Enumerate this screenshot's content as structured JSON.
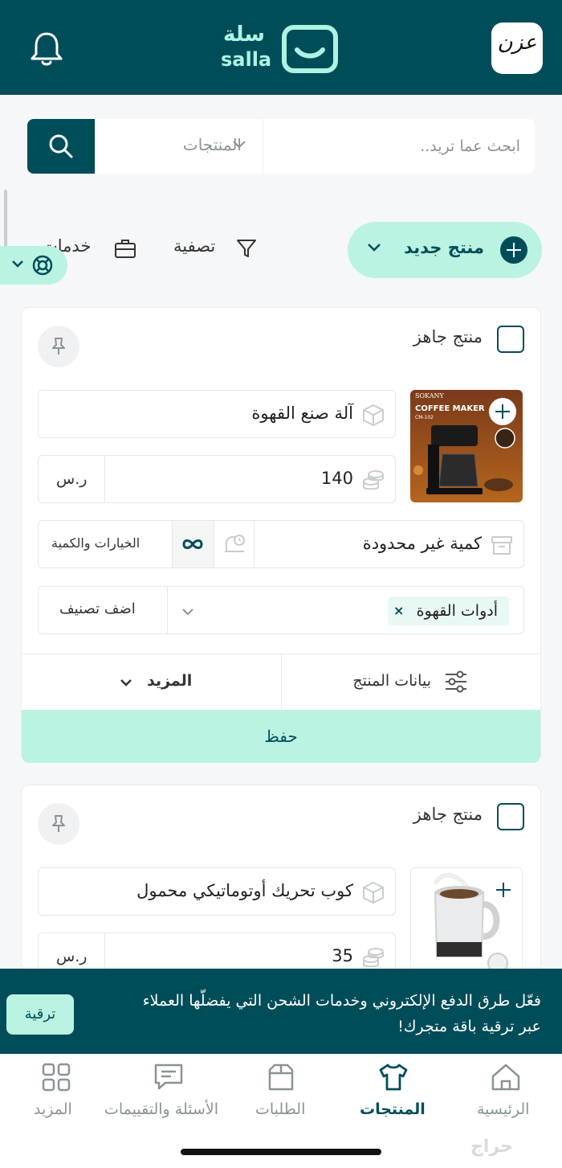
{
  "header": {
    "logo_ar": "سلة",
    "logo_en": "salla",
    "avatar_text": "عزن",
    "bell_icon": "bell-icon",
    "brand_color": "#004d5a",
    "accent_color": "#baf3e2"
  },
  "search": {
    "placeholder": "ابحث عما تريد..",
    "category": "المنتجات"
  },
  "toolbar": {
    "new_product": "منتج جديد",
    "filter": "تصفية",
    "services": "خدمات"
  },
  "products": [
    {
      "ready_label": "منتج جاهز",
      "name": "آلة صنع القهوة",
      "price": "140",
      "currency": "ر.س",
      "quantity": "كمية غير محدودة",
      "options_label": "الخيارات والكمية",
      "category_tag": "أدوات القهوة",
      "add_category": "اضف تصنيف",
      "product_data": "بيانات المنتج",
      "more": "المزيد",
      "save": "حفظ",
      "image_brand": "SOKANY",
      "image_title": "COFFEE MAKER",
      "image_model": "CM-102"
    },
    {
      "ready_label": "منتج جاهز",
      "name": "كوب تحريك أوتوماتيكي محمول",
      "price": "35",
      "currency": "ر.س"
    }
  ],
  "promo": {
    "message": "فعّل طرق الدفع الإلكتروني وخدمات الشحن التي يفضلّها العملاء عبر ترقية باقة متجرك!",
    "upgrade": "ترقية"
  },
  "nav": {
    "home": "الرئيسية",
    "products": "المنتجات",
    "orders": "الطلبات",
    "questions": "الأسئلة والتقييمات",
    "more": "المزيد"
  },
  "watermark": "حراج"
}
